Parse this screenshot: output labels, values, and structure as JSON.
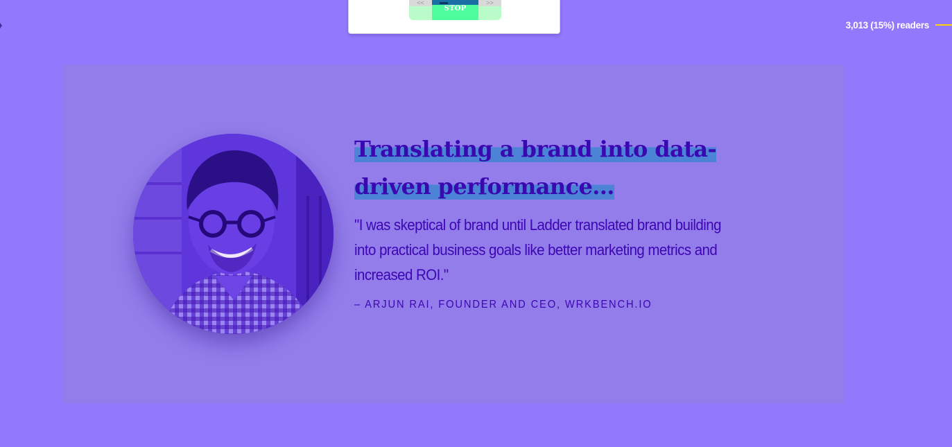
{
  "player": {
    "prev_glyph": "<<",
    "next_glyph": ">>",
    "stop_label": "STOP"
  },
  "readers": {
    "text": "3,013 (15%) readers",
    "line_color": "#ffd400"
  },
  "testimonial": {
    "headline": "Translating a brand into data-driven performance...",
    "quote": "\"I was skeptical of brand until Ladder translated brand building into practical business goals like better marketing metrics and increased ROI.\"",
    "attribution": "– Arjun Rai, Founder and CEO, Wrkbench.io",
    "avatar_icon": "person-photo",
    "highlight_color": "#4d83d7"
  },
  "colors": {
    "page_background": "#9278fd",
    "section_background": "#937deb",
    "text": "#3d06b2",
    "stop_button": "#4dfd9d"
  }
}
